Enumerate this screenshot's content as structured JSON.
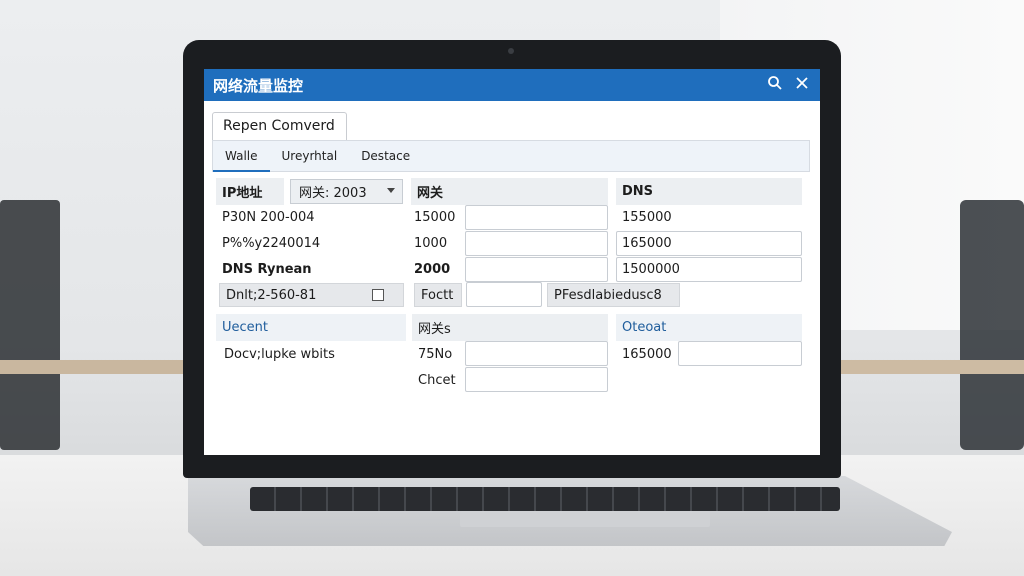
{
  "window": {
    "title": "网络流量监控",
    "search_icon": "search-icon",
    "close_icon": "close-icon"
  },
  "tab": {
    "label": "Repen Comverd"
  },
  "subtabs": [
    "Walle",
    "Ureyrhtal",
    "Destace"
  ],
  "form": {
    "col1_header": "IP地址",
    "select_value": "网关: 2003",
    "col2_header": "网关",
    "col3_header": "DNS",
    "rows": [
      {
        "label": "P30N 200-004",
        "mid": "15000",
        "right": "155000"
      },
      {
        "label": "P%%y2240014",
        "mid": "1000",
        "right": "165000"
      },
      {
        "label": "DNS Rynean",
        "mid": "2000",
        "right": "1500000"
      }
    ],
    "grey_left": "Dnlt;2-560-81",
    "grey_mid": "Foctt",
    "grey_right": "PFesdlabiedusc8",
    "section2": {
      "left_header": "Uecent",
      "mid_header": "网关s",
      "right_header": "Oteoat",
      "row1_label": "Docv;lupke wbits",
      "row1_mid": "75No",
      "row1_right": "165000",
      "row2_mid": "Chcet"
    }
  }
}
